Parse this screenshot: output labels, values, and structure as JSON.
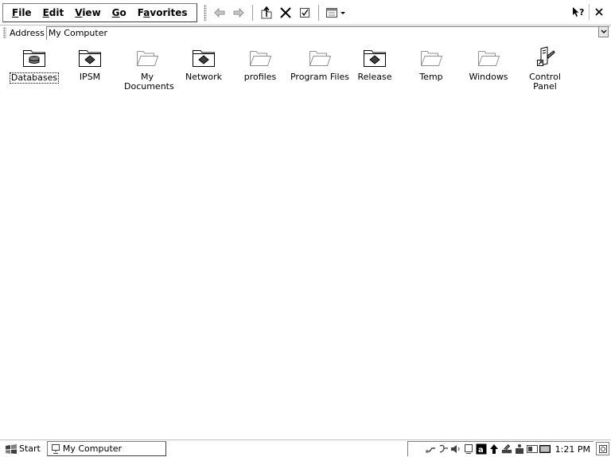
{
  "menubar": {
    "items": [
      {
        "label": "File",
        "accel": "F",
        "rest": "ile"
      },
      {
        "label": "Edit",
        "accel": "E",
        "rest": "dit"
      },
      {
        "label": "View",
        "accel": "V",
        "rest": "iew"
      },
      {
        "label": "Go",
        "accel": "G",
        "rest": "o"
      },
      {
        "label": "Favorites",
        "accel": "a",
        "pre": "F",
        "rest": "vorites"
      }
    ],
    "toolbar_icons": [
      "back-arrow-icon",
      "forward-arrow-icon",
      "up-folder-icon",
      "delete-x-icon",
      "properties-icon",
      "views-dropdown-icon"
    ],
    "right_icons": [
      "help-icon",
      "close-icon"
    ]
  },
  "address": {
    "label": "Address",
    "value": "My Computer"
  },
  "items": [
    {
      "label": "Databases",
      "icon": "database-folder-icon"
    },
    {
      "label": "IPSM",
      "icon": "storage-folder-icon"
    },
    {
      "label": "My Documents",
      "icon": "folder-icon"
    },
    {
      "label": "Network",
      "icon": "storage-folder-icon"
    },
    {
      "label": "profiles",
      "icon": "folder-icon"
    },
    {
      "label": "Program Files",
      "icon": "folder-icon"
    },
    {
      "label": "Release",
      "icon": "storage-folder-icon"
    },
    {
      "label": "Temp",
      "icon": "folder-icon"
    },
    {
      "label": "Windows",
      "icon": "folder-icon"
    },
    {
      "label": "Control Panel",
      "icon": "control-panel-shortcut-icon"
    }
  ],
  "taskbar": {
    "start_label": "Start",
    "task_label": "My Computer",
    "clock": "1:21 PM",
    "tray_icons": [
      "network-icon",
      "connection-icon",
      "speaker-icon",
      "pc-icon",
      "input-a-icon",
      "up-arrow-icon",
      "keyboard-icon",
      "user-icon",
      "display-icon",
      "panel-icon"
    ]
  },
  "colors": {
    "background": "#ffffff",
    "text": "#000000",
    "border": "#808080"
  }
}
